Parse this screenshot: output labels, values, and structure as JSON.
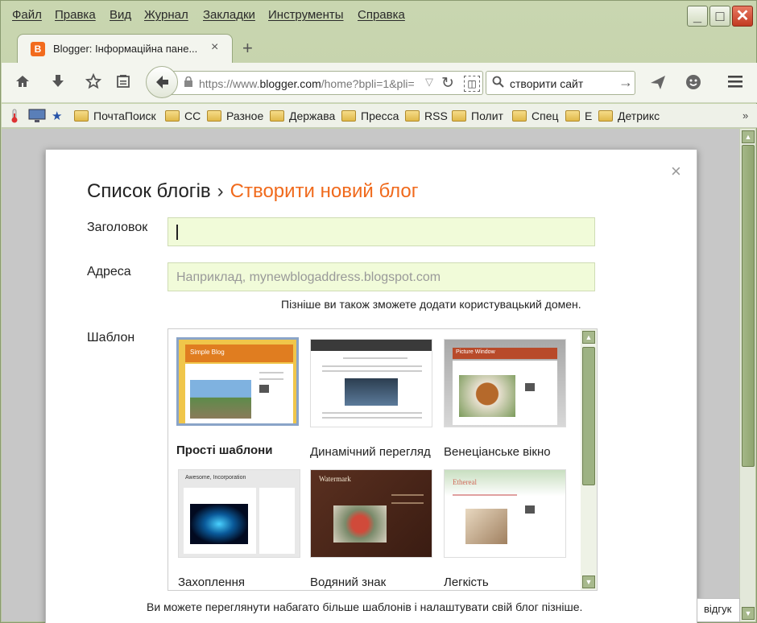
{
  "menubar": {
    "items": [
      "Файл",
      "Правка",
      "Вид",
      "Журнал",
      "Закладки",
      "Инструменты",
      "Справка"
    ]
  },
  "window_controls": {
    "minimize": "_",
    "maximize": "□",
    "close": "✕"
  },
  "tab": {
    "favicon": "B",
    "title": "Blogger: Інформаційна пане...",
    "close": "×"
  },
  "new_tab": "+",
  "toolbar": {
    "url_prefix": "https://www.",
    "url_domain": "blogger.com",
    "url_rest": "/home?bpli=1&pli=",
    "ext_glyph": "◫",
    "search_text": "створити сайт"
  },
  "bookmarks": [
    "ПочтаПоиск",
    "CC",
    "Разное",
    "Держава",
    "Пресса",
    "RSS",
    "Полит",
    "Спец",
    "E",
    "Детрикс"
  ],
  "bookmarks_more": "»",
  "dialog": {
    "close": "×",
    "breadcrumb_parent": "Список блогів",
    "breadcrumb_sep": "›",
    "breadcrumb_current": "Створити новий блог",
    "title_label": "Заголовок",
    "address_label": "Адреса",
    "address_placeholder": "Наприклад, mynewblogaddress.blogspot.com",
    "address_hint": "Пізніше ви також зможете додати користувацький домен.",
    "template_label": "Шаблон",
    "templates": [
      {
        "name": "Прості шаблони",
        "thumb_title": "Simple Blog",
        "selected": true
      },
      {
        "name": "Динамічний перегляд",
        "thumb_title": "",
        "selected": false
      },
      {
        "name": "Венеціанське вікно",
        "thumb_title": "Picture Window",
        "selected": false
      },
      {
        "name": "Захоплення",
        "thumb_title": "Awesome, Incorporation",
        "selected": false
      },
      {
        "name": "Водяний знак",
        "thumb_title": "Watermark",
        "selected": false
      },
      {
        "name": "Легкість",
        "thumb_title": "Ethereal",
        "selected": false
      }
    ],
    "footer_note": "Ви можете переглянути набагато більше шаблонів і налаштувати свій блог пізніше."
  },
  "feedback": "відгук"
}
